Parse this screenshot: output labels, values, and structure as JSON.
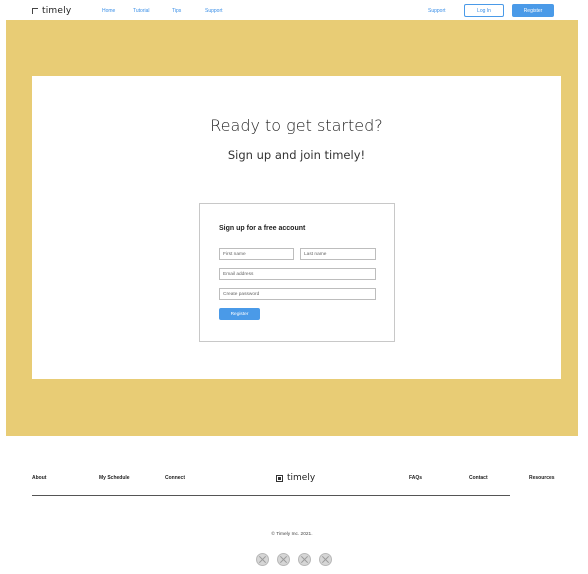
{
  "header": {
    "logo_text": "timely",
    "nav": [
      {
        "label": "Home"
      },
      {
        "label": "Tutorial"
      },
      {
        "label": "Tips"
      },
      {
        "label": "Support"
      }
    ],
    "support_label": "Support",
    "login_label": "Log In",
    "register_label": "Register"
  },
  "hero": {
    "title": "Ready to get started?",
    "subtitle": "Sign up and join timely!"
  },
  "signup": {
    "title": "Sign up for a free account",
    "first_name_placeholder": "First name",
    "last_name_placeholder": "Last name",
    "email_placeholder": "Email address",
    "password_placeholder": "Create password",
    "submit_label": "Register"
  },
  "footer": {
    "links": [
      {
        "label": "About"
      },
      {
        "label": "My Schedule"
      },
      {
        "label": "Connect"
      },
      {
        "label": "FAQs"
      },
      {
        "label": "Contact"
      },
      {
        "label": "Resources"
      }
    ],
    "logo_text": "timely",
    "copyright": "© Timely Inc. 2021.",
    "social_icons": [
      "social-icon",
      "social-icon",
      "social-icon",
      "social-icon"
    ]
  },
  "colors": {
    "hero_bg": "#e8cc75",
    "accent": "#4a9ae8"
  }
}
